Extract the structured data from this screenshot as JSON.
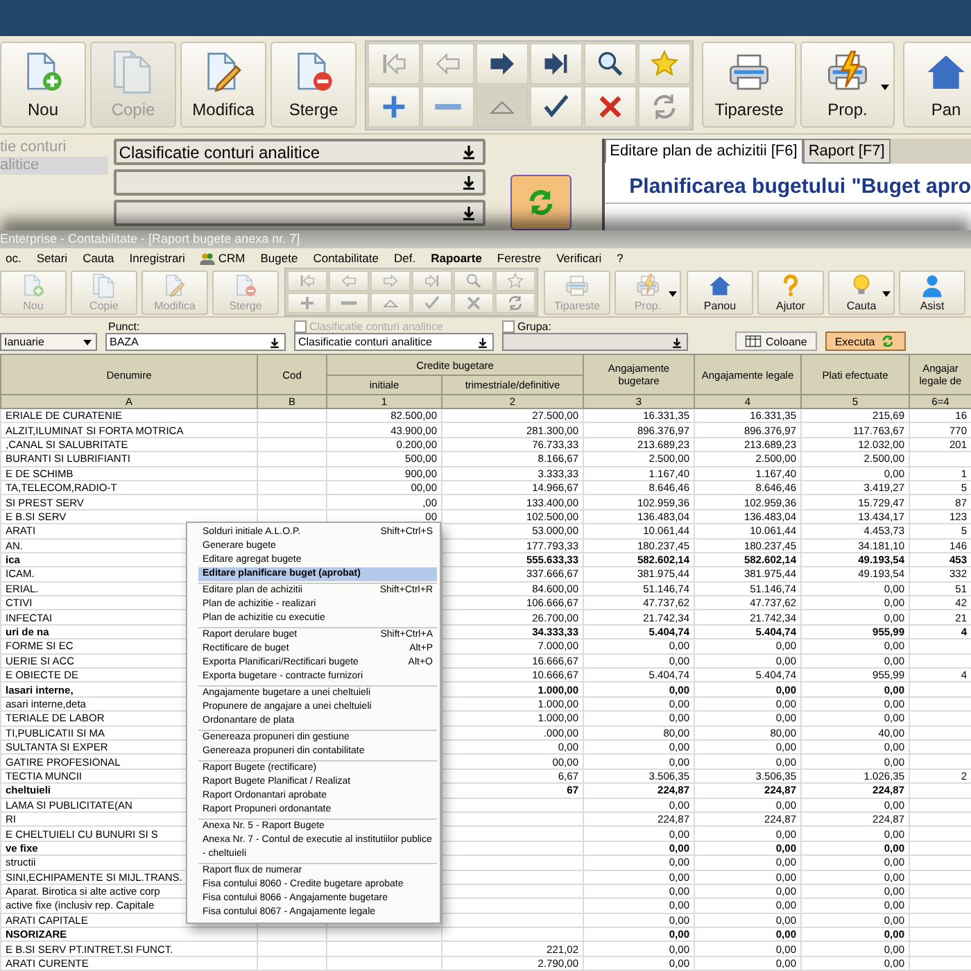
{
  "back_window": {
    "toolbar": {
      "buttons": [
        {
          "kind": "new",
          "label": "Nou",
          "disabled": false
        },
        {
          "kind": "copy",
          "label": "Copie",
          "disabled": true
        },
        {
          "kind": "edit",
          "label": "Modifica",
          "disabled": false
        },
        {
          "kind": "delete",
          "label": "Sterge",
          "disabled": false
        }
      ],
      "nav": [
        {
          "kind": "first",
          "disabled": true
        },
        {
          "kind": "prev",
          "disabled": true
        },
        {
          "kind": "next",
          "disabled": false
        },
        {
          "kind": "last",
          "disabled": false
        },
        {
          "kind": "search",
          "disabled": false
        },
        {
          "kind": "star",
          "disabled": false
        },
        {
          "kind": "add",
          "disabled": false
        },
        {
          "kind": "remove",
          "disabled": false
        },
        {
          "kind": "up",
          "disabled": true
        },
        {
          "kind": "check",
          "disabled": false
        },
        {
          "kind": "cancel",
          "disabled": false
        },
        {
          "kind": "refresh",
          "disabled": true
        }
      ],
      "print_buttons": [
        {
          "kind": "print",
          "label": "Tipareste",
          "dropdown": false,
          "disabled": false
        },
        {
          "kind": "props",
          "label": "Prop.",
          "dropdown": true,
          "disabled": false
        }
      ],
      "extra_buttons": [
        {
          "kind": "home",
          "label": "Pan",
          "disabled": false
        }
      ]
    },
    "filter_label_lines": [
      "tie conturi",
      "alitice"
    ],
    "classification_select": "Clasificatie conturi analitice",
    "tabs": [
      {
        "label": "Editare plan de achizitii [F6]",
        "selected": true
      },
      {
        "label": "Raport [F7]",
        "selected": false
      }
    ],
    "heading": "Planificarea bugetului \"Buget apro"
  },
  "front_window": {
    "title": "Enterprise - Contabilitate - [Raport bugete anexa nr. 7]",
    "menu": [
      {
        "label": "oc.",
        "selected": false,
        "icon": false
      },
      {
        "label": "Setari",
        "selected": false,
        "icon": false
      },
      {
        "label": "Cauta",
        "selected": false,
        "icon": false
      },
      {
        "label": "Inregistrari",
        "selected": false,
        "icon": false
      },
      {
        "label": "CRM",
        "selected": false,
        "icon": true
      },
      {
        "label": "Bugete",
        "selected": false,
        "icon": false
      },
      {
        "label": "Contabilitate",
        "selected": false,
        "icon": false
      },
      {
        "label": "Def.",
        "selected": false,
        "icon": false
      },
      {
        "label": "Rapoarte",
        "selected": true,
        "icon": false
      },
      {
        "label": "Ferestre",
        "selected": false,
        "icon": false
      },
      {
        "label": "Verificari",
        "selected": false,
        "icon": false
      },
      {
        "label": "?",
        "selected": false,
        "icon": false
      }
    ],
    "toolbar": {
      "buttons": [
        {
          "kind": "new",
          "label": "Nou",
          "disabled": true
        },
        {
          "kind": "copy",
          "label": "Copie",
          "disabled": true
        },
        {
          "kind": "edit",
          "label": "Modifica",
          "disabled": true
        },
        {
          "kind": "delete",
          "label": "Sterge",
          "disabled": true
        }
      ],
      "nav": [
        {
          "kind": "first",
          "disabled": true
        },
        {
          "kind": "prev",
          "disabled": true
        },
        {
          "kind": "next",
          "disabled": true
        },
        {
          "kind": "last",
          "disabled": true
        },
        {
          "kind": "search",
          "disabled": true
        },
        {
          "kind": "star",
          "disabled": true
        },
        {
          "kind": "add",
          "disabled": true
        },
        {
          "kind": "remove",
          "disabled": true
        },
        {
          "kind": "up",
          "disabled": true
        },
        {
          "kind": "check",
          "disabled": true
        },
        {
          "kind": "cancel",
          "disabled": true
        },
        {
          "kind": "refresh",
          "disabled": true
        }
      ],
      "print_buttons": [
        {
          "kind": "print",
          "label": "Tipareste",
          "dropdown": false,
          "disabled": true
        },
        {
          "kind": "props",
          "label": "Prop.",
          "dropdown": true,
          "disabled": true
        }
      ],
      "extra_buttons": [
        {
          "kind": "home",
          "label": "Panou",
          "dropdown": false,
          "disabled": false
        },
        {
          "kind": "help",
          "label": "Ajutor",
          "dropdown": false,
          "disabled": false
        },
        {
          "kind": "bulb",
          "label": "Cauta",
          "dropdown": true,
          "disabled": false
        },
        {
          "kind": "person",
          "label": "Asist",
          "dropdown": false,
          "disabled": false
        }
      ]
    },
    "filters": {
      "month": "Ianuarie",
      "punct_label": "Punct:",
      "punct_value": "BAZA",
      "class_check": {
        "label": "Clasificatie conturi analitice",
        "checked": false
      },
      "class_select": "Clasificatie conturi analitice",
      "grupa": {
        "label": "Grupa:",
        "checked": false
      },
      "buttons": [
        {
          "kind": "columns",
          "label": "Coloane"
        },
        {
          "kind": "run",
          "label": "Executa"
        }
      ]
    },
    "table": {
      "head": {
        "name": "Denumire",
        "code": "Cod",
        "group": "Credite bugetare",
        "group_sub": [
          "initiale",
          "trimestriale/definitive"
        ],
        "rest": [
          "Angajamente bugetare",
          "Angajamente legale",
          "Plati efectuate",
          "Angajar legale de"
        ]
      },
      "index_row": [
        "A",
        "B",
        "1",
        "2",
        "3",
        "4",
        "5",
        "6=4"
      ],
      "rows": [
        {
          "bold": false,
          "cells": [
            "ERIALE DE CURATENIE",
            null,
            "82.500,00",
            "27.500,00",
            "16.331,35",
            "16.331,35",
            "215,69",
            "16"
          ]
        },
        {
          "bold": false,
          "cells": [
            "ALZIT,ILUMINAT SI FORTA MOTRICA",
            null,
            "43.900,00",
            "281.300,00",
            "896.376,97",
            "896.376,97",
            "117.763,67",
            "770"
          ]
        },
        {
          "bold": false,
          "cells": [
            ",CANAL SI SALUBRITATE",
            null,
            "0.200,00",
            "76.733,33",
            "213.689,23",
            "213.689,23",
            "12.032,00",
            "201"
          ]
        },
        {
          "bold": false,
          "cells": [
            "BURANTI SI LUBRIFIANTI",
            null,
            "500,00",
            "8.166,67",
            "2.500,00",
            "2.500,00",
            "2.500,00",
            null
          ]
        },
        {
          "bold": false,
          "cells": [
            "E DE SCHIMB",
            null,
            "900,00",
            "3.333,33",
            "1.167,40",
            "1.167,40",
            "0,00",
            "1"
          ]
        },
        {
          "bold": false,
          "cells": [
            "TA,TELECOM,RADIO-T",
            null,
            "00,00",
            "14.966,67",
            "8.646,46",
            "8.646,46",
            "3.419,27",
            "5"
          ]
        },
        {
          "bold": false,
          "cells": [
            "SI PREST SERV",
            null,
            ",00",
            "133.400,00",
            "102.959,36",
            "102.959,36",
            "15.729,47",
            "87"
          ]
        },
        {
          "bold": false,
          "cells": [
            "E B.SI SERV",
            null,
            "00",
            "102.500,00",
            "136.483,04",
            "136.483,04",
            "13.434,17",
            "123"
          ]
        },
        {
          "bold": false,
          "cells": [
            "ARATI",
            null,
            null,
            "53.000,00",
            "10.061,44",
            "10.061,44",
            "4.453,73",
            "5"
          ]
        },
        {
          "bold": false,
          "cells": [
            "AN.",
            null,
            null,
            "177.793,33",
            "180.237,45",
            "180.237,45",
            "34.181,10",
            "146"
          ]
        },
        {
          "bold": true,
          "cells": [
            "ica",
            null,
            null,
            "555.633,33",
            "582.602,14",
            "582.602,14",
            "49.193,54",
            "453"
          ]
        },
        {
          "bold": false,
          "cells": [
            "ICAM.",
            null,
            null,
            "337.666,67",
            "381.975,44",
            "381.975,44",
            "49.193,54",
            "332"
          ]
        },
        {
          "bold": false,
          "cells": [
            "ERIAL.",
            null,
            null,
            "84.600,00",
            "51.146,74",
            "51.146,74",
            "0,00",
            "51"
          ]
        },
        {
          "bold": false,
          "cells": [
            "CTIVI",
            null,
            null,
            "106.666,67",
            "47.737,62",
            "47.737,62",
            "0,00",
            "42"
          ]
        },
        {
          "bold": false,
          "cells": [
            "INFECTAI",
            null,
            null,
            "26.700,00",
            "21.742,34",
            "21.742,34",
            "0,00",
            "21"
          ]
        },
        {
          "bold": true,
          "cells": [
            "uri de na",
            null,
            null,
            "34.333,33",
            "5.404,74",
            "5.404,74",
            "955,99",
            "4"
          ]
        },
        {
          "bold": false,
          "cells": [
            "FORME SI EC",
            null,
            null,
            "7.000,00",
            "0,00",
            "0,00",
            "0,00",
            null
          ]
        },
        {
          "bold": false,
          "cells": [
            "UERIE SI ACC",
            null,
            null,
            "16.666,67",
            "0,00",
            "0,00",
            "0,00",
            null
          ]
        },
        {
          "bold": false,
          "cells": [
            "E OBIECTE DE",
            null,
            null,
            "10.666,67",
            "5.404,74",
            "5.404,74",
            "955,99",
            "4"
          ]
        },
        {
          "bold": true,
          "cells": [
            "lasari interne,",
            null,
            null,
            "1.000,00",
            "0,00",
            "0,00",
            "0,00",
            null
          ]
        },
        {
          "bold": false,
          "cells": [
            "asari interne,deta",
            null,
            null,
            "1.000,00",
            "0,00",
            "0,00",
            "0,00",
            null
          ]
        },
        {
          "bold": false,
          "cells": [
            "TERIALE DE LABOR",
            null,
            null,
            "1.000,00",
            "0,00",
            "0,00",
            "0,00",
            null
          ]
        },
        {
          "bold": false,
          "cells": [
            "TI,PUBLICATII SI MA",
            null,
            null,
            ".000,00",
            "80,00",
            "80,00",
            "40,00",
            null
          ]
        },
        {
          "bold": false,
          "cells": [
            "SULTANTA SI EXPER",
            null,
            null,
            "0,00",
            "0,00",
            "0,00",
            "0,00",
            null
          ]
        },
        {
          "bold": false,
          "cells": [
            "GATIRE PROFESIONAL",
            null,
            null,
            "00,00",
            "0,00",
            "0,00",
            "0,00",
            null
          ]
        },
        {
          "bold": false,
          "cells": [
            "TECTIA MUNCII",
            null,
            null,
            "6,67",
            "3.506,35",
            "3.506,35",
            "1.026,35",
            "2"
          ]
        },
        {
          "bold": true,
          "cells": [
            "cheltuieli",
            null,
            null,
            "67",
            "224,87",
            "224,87",
            "224,87",
            null
          ]
        },
        {
          "bold": false,
          "cells": [
            "LAMA SI PUBLICITATE(AN",
            null,
            null,
            null,
            "0,00",
            "0,00",
            "0,00",
            null
          ]
        },
        {
          "bold": false,
          "cells": [
            "RI",
            null,
            null,
            null,
            "224,87",
            "224,87",
            "224,87",
            null
          ]
        },
        {
          "bold": false,
          "cells": [
            "E CHELTUIELI CU BUNURI SI S",
            null,
            null,
            null,
            "0,00",
            "0,00",
            "0,00",
            null
          ]
        },
        {
          "bold": true,
          "cells": [
            "ve fixe",
            null,
            null,
            null,
            "0,00",
            "0,00",
            "0,00",
            null
          ]
        },
        {
          "bold": false,
          "cells": [
            "structii",
            null,
            null,
            null,
            "0,00",
            "0,00",
            "0,00",
            null
          ]
        },
        {
          "bold": false,
          "cells": [
            "SINI,ECHIPAMENTE SI MIJL.TRANS.",
            null,
            null,
            null,
            "0,00",
            "0,00",
            "0,00",
            null
          ]
        },
        {
          "bold": false,
          "cells": [
            "Aparat. Birotica si alte active corp",
            null,
            null,
            null,
            "0,00",
            "0,00",
            "0,00",
            null
          ]
        },
        {
          "bold": false,
          "cells": [
            "active fixe (inclusiv rep. Capitale",
            null,
            null,
            null,
            "0,00",
            "0,00",
            "0,00",
            null
          ]
        },
        {
          "bold": false,
          "cells": [
            "ARATI CAPITALE",
            null,
            null,
            null,
            "0,00",
            "0,00",
            "0,00",
            null
          ]
        },
        {
          "bold": true,
          "cells": [
            "NSORIZARE",
            null,
            null,
            null,
            "0,00",
            "0,00",
            "0,00",
            null
          ]
        },
        {
          "bold": false,
          "cells": [
            "E B.SI SERV PT.INTRET.SI FUNCT.",
            null,
            null,
            "221,02",
            "0,00",
            "0,00",
            "0,00",
            null
          ]
        },
        {
          "bold": false,
          "cells": [
            "ARATI CURENTE",
            null,
            null,
            "2.790,00",
            "0,00",
            "0,00",
            "0,00",
            null
          ]
        }
      ]
    }
  },
  "context_menu": [
    {
      "kind": "item",
      "label": "Solduri initiale A.L.O.P.",
      "shortcut": "Shift+Ctrl+S",
      "selected": false
    },
    {
      "kind": "item",
      "label": "Generare bugete",
      "selected": false
    },
    {
      "kind": "item",
      "label": "Editare agregat bugete",
      "selected": false
    },
    {
      "kind": "item",
      "label": "Editare planificare buget (aprobat)",
      "selected": true
    },
    {
      "kind": "separator"
    },
    {
      "kind": "item",
      "label": "Editare plan de achizitii",
      "shortcut": "Shift+Ctrl+R",
      "selected": false
    },
    {
      "kind": "item",
      "label": "Plan de achizitie - realizari",
      "selected": false
    },
    {
      "kind": "item",
      "label": "Plan de achizitie cu executie",
      "selected": false
    },
    {
      "kind": "separator"
    },
    {
      "kind": "item",
      "label": "Raport derulare buget",
      "shortcut": "Shift+Ctrl+A",
      "selected": false
    },
    {
      "kind": "item",
      "label": "Rectificare de buget",
      "shortcut": "Alt+P",
      "selected": false
    },
    {
      "kind": "item",
      "label": "Exporta Planificari/Rectificari bugete",
      "shortcut": "Alt+O",
      "selected": false
    },
    {
      "kind": "item",
      "label": "Exporta bugetare - contracte furnizori",
      "selected": false
    },
    {
      "kind": "separator"
    },
    {
      "kind": "item",
      "label": "Angajamente bugetare a unei cheltuieli",
      "selected": false
    },
    {
      "kind": "item",
      "label": "Propunere de angajare a unei cheltuieli",
      "selected": false
    },
    {
      "kind": "item",
      "label": "Ordonantare de plata",
      "selected": false
    },
    {
      "kind": "separator"
    },
    {
      "kind": "item",
      "label": "Genereaza propuneri din gestiune",
      "selected": false
    },
    {
      "kind": "item",
      "label": "Genereaza propuneri din contabilitate",
      "selected": false
    },
    {
      "kind": "separator"
    },
    {
      "kind": "item",
      "label": "Raport Bugete (rectificare)",
      "selected": false
    },
    {
      "kind": "item",
      "label": "Raport Bugete Planificat / Realizat",
      "selected": false
    },
    {
      "kind": "item",
      "label": "Raport Ordonantari aprobate",
      "selected": false
    },
    {
      "kind": "item",
      "label": "Raport Propuneri ordonantate",
      "selected": false
    },
    {
      "kind": "separator"
    },
    {
      "kind": "item",
      "label": "Anexa Nr. 5 - Raport Bugete",
      "selected": false
    },
    {
      "kind": "item",
      "label": "Anexa Nr. 7 - Contul de executie al institutiilor publice - cheltuieli",
      "selected": false
    },
    {
      "kind": "separator"
    },
    {
      "kind": "item",
      "label": "Raport flux de numerar",
      "selected": false
    },
    {
      "kind": "item",
      "label": "Fisa contului 8060 - Credite bugetare aprobate",
      "selected": false
    },
    {
      "kind": "item",
      "label": "Fisa contului 8066 - Angajamente bugetare",
      "selected": false
    },
    {
      "kind": "item",
      "label": "Fisa contului 8067 - Angajamente legale",
      "selected": false
    }
  ]
}
